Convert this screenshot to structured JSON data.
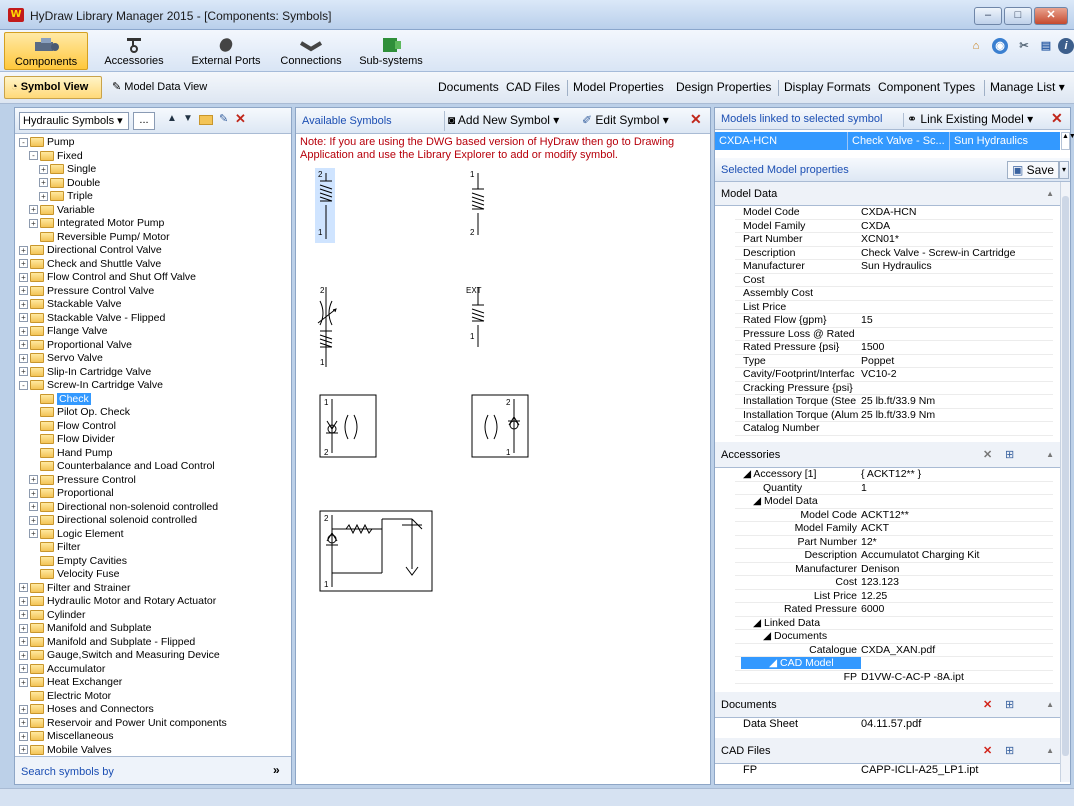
{
  "window": {
    "title": "HyDraw Library Manager 2015 - [Components: Symbols]",
    "app_icon": "W"
  },
  "ribbon": {
    "items": [
      {
        "label": "Components",
        "icon": "components-icon"
      },
      {
        "label": "Accessories",
        "icon": "accessories-icon"
      },
      {
        "label": "External Ports",
        "icon": "external-ports-icon"
      },
      {
        "label": "Connections",
        "icon": "connections-icon"
      },
      {
        "label": "Sub-systems",
        "icon": "sub-systems-icon"
      }
    ]
  },
  "toolbar2": {
    "symbol_view": "Symbol View",
    "model_data_view": "Model Data View",
    "documents": "Documents",
    "cad_files": "CAD Files",
    "model_properties": "Model Properties",
    "design_properties": "Design Properties",
    "display_formats": "Display Formats",
    "component_types": "Component Types",
    "manage_list": "Manage List ▾"
  },
  "left": {
    "library": "Hydraulic Symbols",
    "more": "...",
    "search_label": "Search symbols by",
    "tree": [
      {
        "label": "Pump",
        "level": 0,
        "pm": "-"
      },
      {
        "label": "Fixed",
        "level": 1,
        "pm": "-"
      },
      {
        "label": "Single",
        "level": 2,
        "pm": "+"
      },
      {
        "label": "Double",
        "level": 2,
        "pm": "+"
      },
      {
        "label": "Triple",
        "level": 2,
        "pm": "+"
      },
      {
        "label": "Variable",
        "level": 1,
        "pm": "+"
      },
      {
        "label": "Integrated Motor Pump",
        "level": 1,
        "pm": "+"
      },
      {
        "label": "Reversible Pump/ Motor",
        "level": 1,
        "pm": ""
      },
      {
        "label": "Directional Control Valve",
        "level": 0,
        "pm": "+"
      },
      {
        "label": "Check and Shuttle Valve",
        "level": 0,
        "pm": "+"
      },
      {
        "label": "Flow Control and Shut Off Valve",
        "level": 0,
        "pm": "+"
      },
      {
        "label": "Pressure Control Valve",
        "level": 0,
        "pm": "+"
      },
      {
        "label": "Stackable Valve",
        "level": 0,
        "pm": "+"
      },
      {
        "label": "Stackable Valve - Flipped",
        "level": 0,
        "pm": "+"
      },
      {
        "label": "Flange Valve",
        "level": 0,
        "pm": "+"
      },
      {
        "label": "Proportional Valve",
        "level": 0,
        "pm": "+"
      },
      {
        "label": "Servo Valve",
        "level": 0,
        "pm": "+"
      },
      {
        "label": "Slip-In Cartridge Valve",
        "level": 0,
        "pm": "+"
      },
      {
        "label": "Screw-In Cartridge Valve",
        "level": 0,
        "pm": "-"
      },
      {
        "label": "Check",
        "level": 1,
        "pm": "",
        "selected": true
      },
      {
        "label": "Pilot Op. Check",
        "level": 1,
        "pm": ""
      },
      {
        "label": "Flow Control",
        "level": 1,
        "pm": ""
      },
      {
        "label": "Flow Divider",
        "level": 1,
        "pm": ""
      },
      {
        "label": "Hand Pump",
        "level": 1,
        "pm": ""
      },
      {
        "label": "Counterbalance and Load Control",
        "level": 1,
        "pm": ""
      },
      {
        "label": "Pressure Control",
        "level": 1,
        "pm": "+"
      },
      {
        "label": "Proportional",
        "level": 1,
        "pm": "+"
      },
      {
        "label": "Directional non-solenoid controlled",
        "level": 1,
        "pm": "+"
      },
      {
        "label": "Directional solenoid controlled",
        "level": 1,
        "pm": "+"
      },
      {
        "label": "Logic Element",
        "level": 1,
        "pm": "+"
      },
      {
        "label": "Filter",
        "level": 1,
        "pm": ""
      },
      {
        "label": "Empty Cavities",
        "level": 1,
        "pm": ""
      },
      {
        "label": "Velocity Fuse",
        "level": 1,
        "pm": ""
      },
      {
        "label": "Filter and Strainer",
        "level": 0,
        "pm": "+"
      },
      {
        "label": "Hydraulic Motor and Rotary Actuator",
        "level": 0,
        "pm": "+"
      },
      {
        "label": "Cylinder",
        "level": 0,
        "pm": "+"
      },
      {
        "label": "Manifold and Subplate",
        "level": 0,
        "pm": "+"
      },
      {
        "label": "Manifold and Subplate - Flipped",
        "level": 0,
        "pm": "+"
      },
      {
        "label": "Gauge,Switch and Measuring Device",
        "level": 0,
        "pm": "+"
      },
      {
        "label": "Accumulator",
        "level": 0,
        "pm": "+"
      },
      {
        "label": "Heat Exchanger",
        "level": 0,
        "pm": "+"
      },
      {
        "label": "Electric Motor",
        "level": 0,
        "pm": ""
      },
      {
        "label": "Hoses and Connectors",
        "level": 0,
        "pm": "+"
      },
      {
        "label": "Reservoir and Power Unit components",
        "level": 0,
        "pm": "+"
      },
      {
        "label": "Miscellaneous",
        "level": 0,
        "pm": "+"
      },
      {
        "label": "Mobile Valves",
        "level": 0,
        "pm": "+"
      }
    ]
  },
  "middle": {
    "header": "Available Symbols",
    "add_new": "Add New Symbol",
    "edit": "Edit Symbol",
    "note": "Note: If you are using the DWG based version of HyDraw then go to Drawing Application and use the Library Explorer to add or modify symbol.",
    "symbol_labels": {
      "one": "1",
      "two": "2",
      "ext": "EXT"
    }
  },
  "right": {
    "linked_header": "Models linked to selected symbol",
    "link_existing": "Link Existing Model",
    "linked_row": {
      "code": "CXDA-HCN",
      "desc": "Check Valve - Sc...",
      "mfr": "Sun Hydraulics"
    },
    "selected_props": "Selected Model properties",
    "save": "Save",
    "model_data_header": "Model Data",
    "model_data": [
      {
        "k": "Model Code",
        "v": "CXDA-HCN"
      },
      {
        "k": "Model Family",
        "v": "CXDA"
      },
      {
        "k": "Part Number",
        "v": "XCN01*"
      },
      {
        "k": "Description",
        "v": "Check Valve - Screw-in Cartridge"
      },
      {
        "k": "Manufacturer",
        "v": "Sun Hydraulics"
      },
      {
        "k": "Cost",
        "v": ""
      },
      {
        "k": "Assembly Cost",
        "v": ""
      },
      {
        "k": "List Price",
        "v": ""
      },
      {
        "k": "Rated Flow {gpm}",
        "v": "15"
      },
      {
        "k": "Pressure Loss @ Rated",
        "v": ""
      },
      {
        "k": "Rated Pressure {psi}",
        "v": "1500"
      },
      {
        "k": "Type",
        "v": "Poppet"
      },
      {
        "k": "Cavity/Footprint/Interfac",
        "v": "VC10-2"
      },
      {
        "k": "Cracking Pressure {psi}",
        "v": ""
      },
      {
        "k": "Installation Torque (Stee",
        "v": "25 lb.ft/33.9 Nm"
      },
      {
        "k": "Installation Torque (Alum",
        "v": "25 lb.ft/33.9 Nm"
      },
      {
        "k": "Catalog Number",
        "v": ""
      }
    ],
    "accessories_header": "Accessories",
    "accessories": [
      {
        "k": "◢  Accessory [1]",
        "v": "{ ACKT12** }",
        "indent": 0
      },
      {
        "k": "Quantity",
        "v": "1",
        "indent": 2
      },
      {
        "k": "◢  Model Data",
        "v": "",
        "indent": 1
      },
      {
        "k": "Model Code",
        "v": "ACKT12**",
        "indent": 3,
        "right": true
      },
      {
        "k": "Model Family",
        "v": "ACKT",
        "indent": 3,
        "right": true
      },
      {
        "k": "Part Number",
        "v": "12*",
        "indent": 3,
        "right": true
      },
      {
        "k": "Description",
        "v": "Accumulatot Charging Kit",
        "indent": 3,
        "right": true
      },
      {
        "k": "Manufacturer",
        "v": "Denison",
        "indent": 3,
        "right": true
      },
      {
        "k": "Cost",
        "v": "123.123",
        "indent": 3,
        "right": true
      },
      {
        "k": "List Price",
        "v": "12.25",
        "indent": 3,
        "right": true
      },
      {
        "k": "Rated Pressure",
        "v": "6000",
        "indent": 3,
        "right": true
      },
      {
        "k": "◢  Linked Data",
        "v": "",
        "indent": 1
      },
      {
        "k": "◢  Documents",
        "v": "",
        "indent": 2
      },
      {
        "k": "Catalogue",
        "v": "CXDA_XAN.pdf",
        "indent": 4,
        "right": true
      },
      {
        "k": "◢  CAD Model",
        "v": "",
        "indent": 2,
        "selected": true
      },
      {
        "k": "FP",
        "v": "D1VW-C-AC-P -8A.ipt",
        "indent": 4,
        "right": true
      }
    ],
    "documents_header": "Documents",
    "documents": [
      {
        "k": "Data Sheet",
        "v": "04.11.57.pdf"
      }
    ],
    "cad_header": "CAD Files",
    "cad": [
      {
        "k": "FP",
        "v": "CAPP-ICLI-A25_LP1.ipt"
      }
    ]
  },
  "colors": {
    "accent": "#3399ff",
    "note": "#b7000b",
    "link": "#1c4fb3"
  }
}
